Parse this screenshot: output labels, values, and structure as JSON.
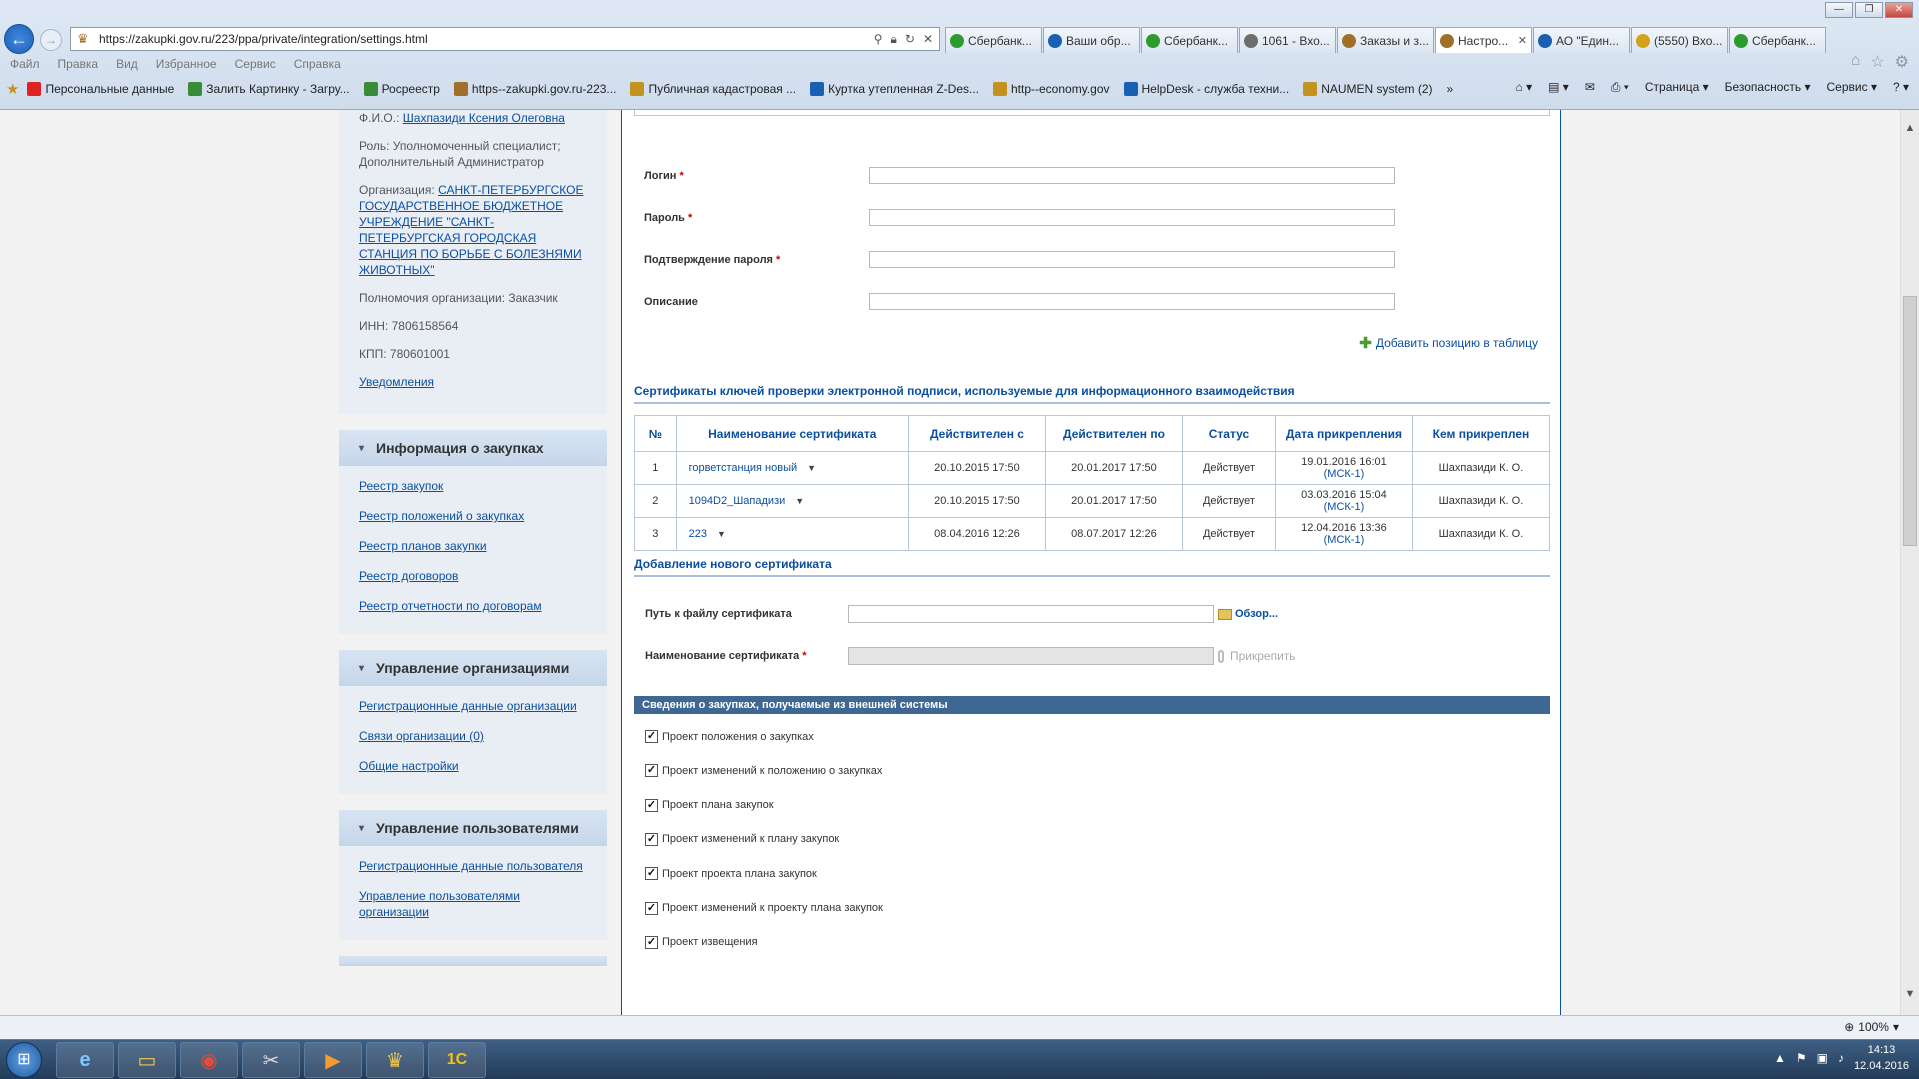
{
  "browser": {
    "url": "https://zakupki.gov.ru/223/ppa/private/integration/settings.html",
    "tabs": [
      {
        "label": "Сбербанк...",
        "color": "#2e9b2e",
        "active": false
      },
      {
        "label": "Ваши обр...",
        "color": "#1b5fb3",
        "active": false
      },
      {
        "label": "Сбербанк...",
        "color": "#2e9b2e",
        "active": false
      },
      {
        "label": "1061 - Вхо...",
        "color": "#6d6d6d",
        "active": false
      },
      {
        "label": "Заказы и з...",
        "color": "#a0702a",
        "active": false
      },
      {
        "label": "Настро...",
        "color": "#a0702a",
        "active": true
      },
      {
        "label": "АО \"Един...",
        "color": "#1b5fb3",
        "active": false
      },
      {
        "label": "(5550) Вхо...",
        "color": "#d4a21a",
        "active": false
      },
      {
        "label": "Сбербанк...",
        "color": "#2e9b2e",
        "active": false
      }
    ],
    "menu": [
      "Файл",
      "Правка",
      "Вид",
      "Избранное",
      "Сервис",
      "Справка"
    ],
    "favorites": [
      {
        "label": "Персональные данные",
        "color": "#d22"
      },
      {
        "label": "Залить Картинку - Загру...",
        "color": "#3a8c3a"
      },
      {
        "label": "Росреестр",
        "color": "#3a8c3a"
      },
      {
        "label": "https--zakupki.gov.ru-223...",
        "color": "#a0702a"
      },
      {
        "label": "Публичная кадастровая ...",
        "color": "#c4931f"
      },
      {
        "label": "Куртка утепленная Z-Des...",
        "color": "#1b5fb3"
      },
      {
        "label": "http--economy.gov",
        "color": "#c4931f"
      },
      {
        "label": "HelpDesk - служба техни...",
        "color": "#1b5fb3"
      },
      {
        "label": "NAUMEN system (2)",
        "color": "#c4931f"
      }
    ],
    "commands": [
      "Страница ▾",
      "Безопасность ▾",
      "Сервис ▾"
    ],
    "zoom": "100%"
  },
  "sidebar": {
    "user": {
      "fio_label": "Ф.И.О.:",
      "fio_value": "Шахпазиди Ксения Олеговна",
      "role": "Роль: Уполномоченный специалист; Дополнительный Администратор",
      "org_label": "Организация:",
      "org_value": "САНКТ-ПЕТЕРБУРГСКОЕ ГОСУДАРСТВЕННОЕ БЮДЖЕТНОЕ УЧРЕЖДЕНИЕ \"САНКТ-ПЕТЕРБУРГСКАЯ ГОРОДСКАЯ СТАНЦИЯ ПО БОРЬБЕ С БОЛЕЗНЯМИ ЖИВОТНЫХ\"",
      "powers": "Полномочия организации: Заказчик",
      "inn": "ИНН: 7806158564",
      "kpp": "КПП: 780601001",
      "notifications": "Уведомления"
    },
    "sections": [
      {
        "title": "Информация о закупках",
        "links": [
          "Реестр закупок",
          "Реестр положений о закупках",
          "Реестр планов закупки",
          "Реестр договоров",
          "Реестр отчетности по договорам"
        ]
      },
      {
        "title": "Управление организациями",
        "links": [
          "Регистрационные данные организации",
          "Связи организации (0)",
          "Общие настройки"
        ]
      },
      {
        "title": "Управление пользователями",
        "links": [
          "Регистрационные данные пользователя",
          "Управление пользователями организации"
        ]
      }
    ]
  },
  "form": {
    "login_label": "Логин",
    "password_label": "Пароль",
    "confirm_label": "Подтверждение пароля",
    "description_label": "Описание",
    "required_mark": "*",
    "add_position": "Добавить позицию в таблицу"
  },
  "certificates": {
    "title": "Сертификаты ключей проверки электронной подписи, используемые для информационного взаимодействия",
    "columns": [
      "№",
      "Наименование сертификата",
      "Действителен с",
      "Действителен по",
      "Статус",
      "Дата прикрепления",
      "Кем прикреплен"
    ],
    "rows": [
      {
        "num": "1",
        "name": "горветстанция новый",
        "from": "20.10.2015 17:50",
        "to": "20.01.2017 17:50",
        "status": "Действует",
        "attached": "19.01.2016 16:01",
        "tz": "(МСК-1)",
        "by": "Шахпазиди К. О."
      },
      {
        "num": "2",
        "name": "1094D2_Шападизи",
        "from": "20.10.2015 17:50",
        "to": "20.01.2017 17:50",
        "status": "Действует",
        "attached": "03.03.2016 15:04",
        "tz": "(МСК-1)",
        "by": "Шахпазиди К. О."
      },
      {
        "num": "3",
        "name": "223",
        "from": "08.04.2016 12:26",
        "to": "08.07.2017 12:26",
        "status": "Действует",
        "attached": "12.04.2016 13:36",
        "tz": "(МСК-1)",
        "by": "Шахпазиди К. О."
      }
    ]
  },
  "new_certificate": {
    "title": "Добавление нового сертификата",
    "path_label": "Путь к файлу сертификата",
    "browse": "Обзор...",
    "name_label": "Наименование сертификата",
    "attach": "Прикрепить"
  },
  "external": {
    "header": "Сведения о закупках, получаемые из внешней системы",
    "items": [
      {
        "label": "Проект положения о закупках",
        "checked": true
      },
      {
        "label": "Проект изменений к положению о закупках",
        "checked": true
      },
      {
        "label": "Проект плана закупок",
        "checked": true
      },
      {
        "label": "Проект изменений к плану закупок",
        "checked": true
      },
      {
        "label": "Проект проекта плана закупок",
        "checked": true
      },
      {
        "label": "Проект изменений к проекту плана закупок",
        "checked": true
      },
      {
        "label": "Проект извещения",
        "checked": true
      }
    ]
  },
  "taskbar": {
    "time": "14:13",
    "date": "12.04.2016"
  }
}
